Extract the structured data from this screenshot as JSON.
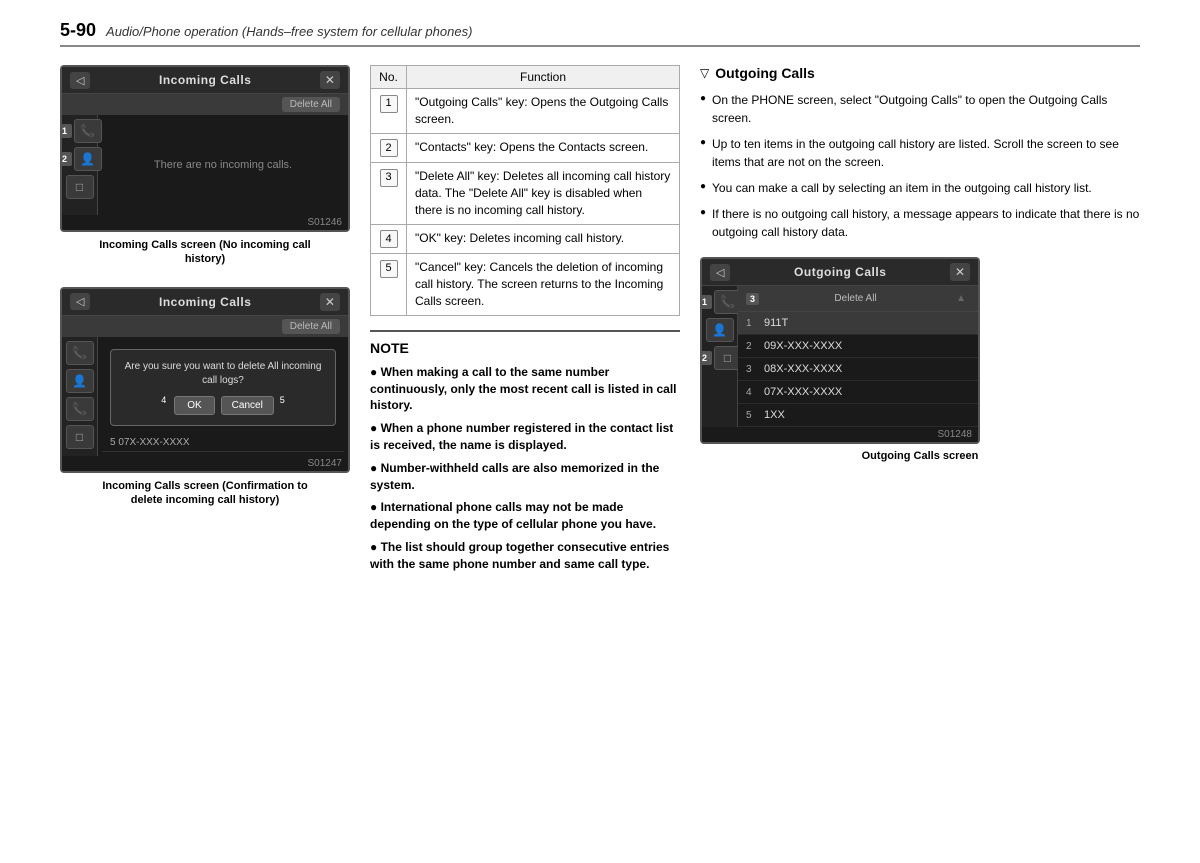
{
  "header": {
    "page_number": "5-90",
    "title": "Audio/Phone operation (Hands–free system for cellular phones)"
  },
  "left_column": {
    "screen1": {
      "title": "Incoming Calls",
      "back_btn": "◁",
      "close_btn": "✕",
      "delete_all_btn": "Delete All",
      "no_items_text": "There are no incoming calls.",
      "image_code": "S01246",
      "caption_line1": "Incoming Calls screen (No incoming call",
      "caption_line2": "history)"
    },
    "screen2": {
      "title": "Incoming Calls",
      "back_btn": "◁",
      "close_btn": "✕",
      "delete_all_btn": "Delete All",
      "confirm_text": "Are you sure you want to delete All incoming call logs?",
      "ok_btn": "OK",
      "cancel_btn": "Cancel",
      "list_item": "5  07X-XXX-XXXX",
      "image_code": "S01247",
      "caption_line1": "Incoming Calls screen (Confirmation to",
      "caption_line2": "delete incoming call history)"
    }
  },
  "table": {
    "col_no": "No.",
    "col_function": "Function",
    "rows": [
      {
        "no": "1",
        "text": "\"Outgoing Calls\" key: Opens the Outgoing Calls screen."
      },
      {
        "no": "2",
        "text": "\"Contacts\" key: Opens the Contacts screen."
      },
      {
        "no": "3",
        "text": "\"Delete All\" key: Deletes all incoming call history data. The \"Delete All\" key is disabled when there is no incoming call history."
      },
      {
        "no": "4",
        "text": "\"OK\" key: Deletes incoming call history."
      },
      {
        "no": "5",
        "text": "\"Cancel\" key: Cancels the deletion of incoming call history. The screen returns to the Incoming Calls screen."
      }
    ]
  },
  "note": {
    "title": "NOTE",
    "items": [
      "When making a call to the same number continuously, only the most recent call is listed in call history.",
      "When a phone number registered in the contact list is received, the name is displayed.",
      "Number-withheld calls are also memorized in the system.",
      "International phone calls may not be made depending on the type of cellular phone you have.",
      "The list should group together consecutive entries with the same phone number and same call type."
    ]
  },
  "right_column": {
    "section_title": "Outgoing Calls",
    "bullets": [
      "On the PHONE screen, select \"Outgoing Calls\" to open the Outgoing Calls screen.",
      "Up to ten items in the outgoing call history are listed. Scroll the screen to see items that are not on the screen.",
      "You can make a call by selecting an item in the outgoing call history list.",
      "If there is no outgoing call history, a message appears to indicate that there is no outgoing call history data."
    ],
    "screen": {
      "title": "Outgoing Calls",
      "back_btn": "◁",
      "close_btn": "✕",
      "delete_all_label": "Delete All",
      "list_items": [
        {
          "num": "1",
          "text": "911T",
          "highlighted": true
        },
        {
          "num": "2",
          "text": "09X-XXX-XXXX",
          "highlighted": false
        },
        {
          "num": "3",
          "text": "08X-XXX-XXXX",
          "highlighted": false
        },
        {
          "num": "4",
          "text": "07X-XXX-XXXX",
          "highlighted": false
        },
        {
          "num": "5",
          "text": "1XX",
          "highlighted": false
        }
      ],
      "image_code": "S01248",
      "caption": "Outgoing Calls screen"
    }
  }
}
